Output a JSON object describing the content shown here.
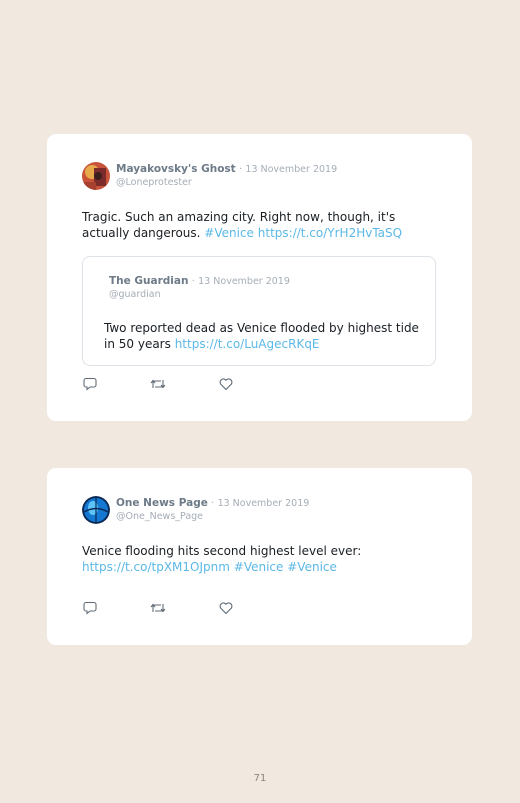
{
  "tweets": [
    {
      "author": "Mayakovsky's Ghost",
      "separator": "·",
      "date": "13 November 2019",
      "handle": "@Loneprotester",
      "text": "Tragic. Such an amazing city. Right now, though, it's actually dangerous.",
      "hashtag": "#Venice",
      "link": "https://t.co/YrH2HvTaSQ",
      "quoted": {
        "author": "The Guardian",
        "separator": "·",
        "date": "13 November 2019",
        "handle": "@guardian",
        "text": "Two reported dead as Venice flooded by highest tide in 50 years",
        "link": "https://t.co/LuAgecRKqE"
      }
    },
    {
      "author": "One News Page",
      "separator": "·",
      "date": "13 November 2019",
      "handle": "@One_News_Page",
      "text": "Venice flooding hits second highest level ever:",
      "link": "https://t.co/tpXM1OJpnm",
      "hashtag1": "#Venice",
      "hashtag2": "#Venice"
    }
  ],
  "icons": [
    "reply-icon",
    "retweet-icon",
    "like-icon"
  ],
  "colors": {
    "link": "#5cb8e6",
    "name": "#6d7a88",
    "background": "#f1e8df"
  },
  "page_number": "71"
}
